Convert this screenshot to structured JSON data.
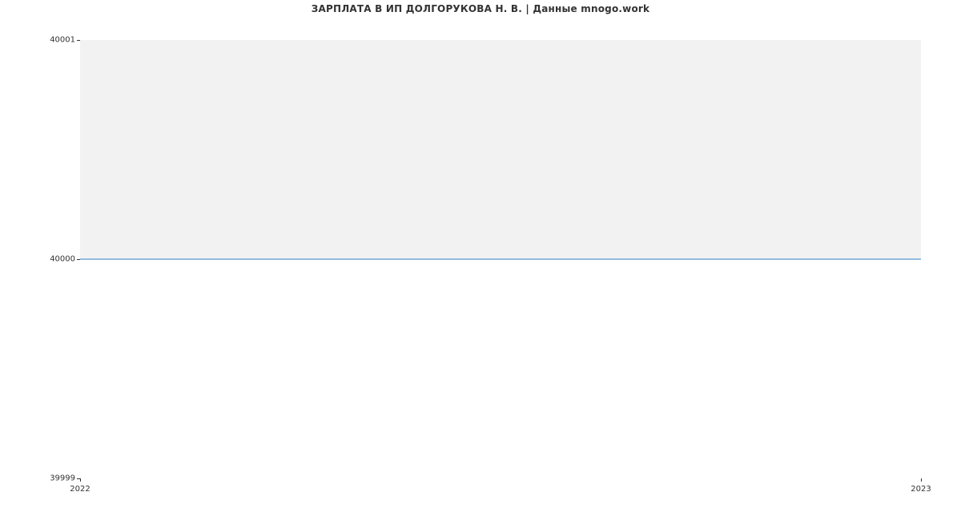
{
  "chart_data": {
    "type": "area",
    "title": "ЗАРПЛАТА В ИП ДОЛГОРУКОВА Н. В. | Данные mnogo.work",
    "x": [
      2022,
      2023
    ],
    "values": [
      40000,
      40000
    ],
    "ylim": [
      39999,
      40001
    ],
    "xlim": [
      2022,
      2023
    ],
    "xlabel": "",
    "ylabel": "",
    "y_ticks": [
      39999,
      40000,
      40001
    ],
    "x_ticks": [
      2022,
      2023
    ],
    "colors": {
      "line": "#2f7ec9",
      "fill": "#f2f2f2"
    }
  }
}
